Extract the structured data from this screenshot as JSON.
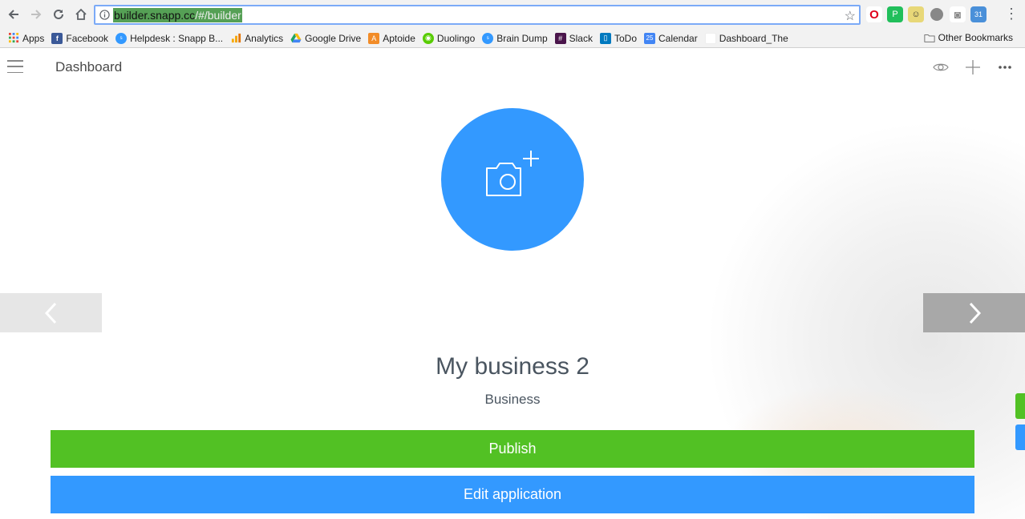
{
  "browser": {
    "url_host": "builder.snapp.cc",
    "url_path": "/#/builder",
    "bookmarks": [
      {
        "label": "Apps",
        "icon": "apps-grid-icon",
        "color": "#4285f4"
      },
      {
        "label": "Facebook",
        "icon": "facebook-icon",
        "color": "#3b5998"
      },
      {
        "label": "Helpdesk : Snapp B...",
        "icon": "snapp-icon",
        "color": "#3399ff"
      },
      {
        "label": "Analytics",
        "icon": "analytics-icon",
        "color": "#f4a300"
      },
      {
        "label": "Google Drive",
        "icon": "google-drive-icon",
        "color": "#1fa463"
      },
      {
        "label": "Aptoide",
        "icon": "aptoide-icon",
        "color": "#f28c28"
      },
      {
        "label": "Duolingo",
        "icon": "duolingo-icon",
        "color": "#58cc02"
      },
      {
        "label": "Brain Dump",
        "icon": "snapp-icon",
        "color": "#3399ff"
      },
      {
        "label": "Slack",
        "icon": "slack-icon",
        "color": "#4a154b"
      },
      {
        "label": "ToDo",
        "icon": "trello-icon",
        "color": "#0079bf"
      },
      {
        "label": "Calendar",
        "icon": "calendar-icon",
        "color": "#4285f4"
      },
      {
        "label": "Dashboard_The",
        "icon": "blank-page-icon",
        "color": "#ffffff"
      }
    ],
    "other_bookmarks": "Other Bookmarks",
    "calendar_day": "25"
  },
  "header": {
    "title": "Dashboard"
  },
  "main": {
    "business_name": "My business 2",
    "business_type": "Business",
    "publish_label": "Publish",
    "edit_label": "Edit application"
  },
  "colors": {
    "primary_blue": "#3399ff",
    "publish_green": "#52c124"
  }
}
